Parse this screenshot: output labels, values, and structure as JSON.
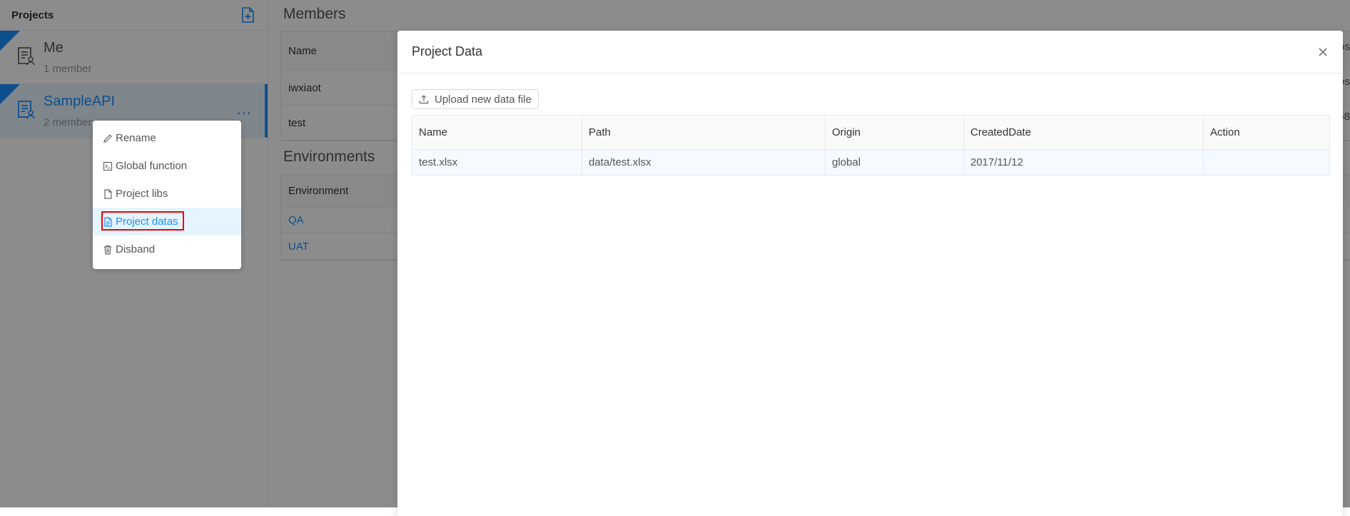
{
  "sidebar": {
    "title": "Projects",
    "projects": [
      {
        "name": "Me",
        "count": "1 member"
      },
      {
        "name": "SampleAPI",
        "count": "2 member"
      }
    ],
    "more_label": "..."
  },
  "context_menu": {
    "items": [
      {
        "label": "Rename",
        "icon": "pencil-icon"
      },
      {
        "label": "Global function",
        "icon": "terminal-icon"
      },
      {
        "label": "Project libs",
        "icon": "file-icon"
      },
      {
        "label": "Project datas",
        "icon": "file-text-icon"
      },
      {
        "label": "Disband",
        "icon": "trash-icon"
      }
    ]
  },
  "main": {
    "members_title": "Members",
    "members_header": "Name",
    "members": [
      "iwxiaot",
      "test"
    ],
    "environments_title": "Environments",
    "environments_header": "Environment",
    "environments": [
      "QA",
      "UAT"
    ],
    "clipped_header": "os",
    "clipped_cells": [
      "os",
      "68"
    ]
  },
  "modal": {
    "title": "Project Data",
    "upload_label": "Upload new data file",
    "columns": [
      "Name",
      "Path",
      "Origin",
      "CreatedDate",
      "Action"
    ],
    "rows": [
      {
        "name": "test.xlsx",
        "path": "data/test.xlsx",
        "origin": "global",
        "created": "2017/11/12",
        "action": ""
      }
    ]
  },
  "colors": {
    "accent": "#1890ff",
    "highlight_box": "#ee0000",
    "mask": "rgba(0,0,0,0.45)"
  }
}
